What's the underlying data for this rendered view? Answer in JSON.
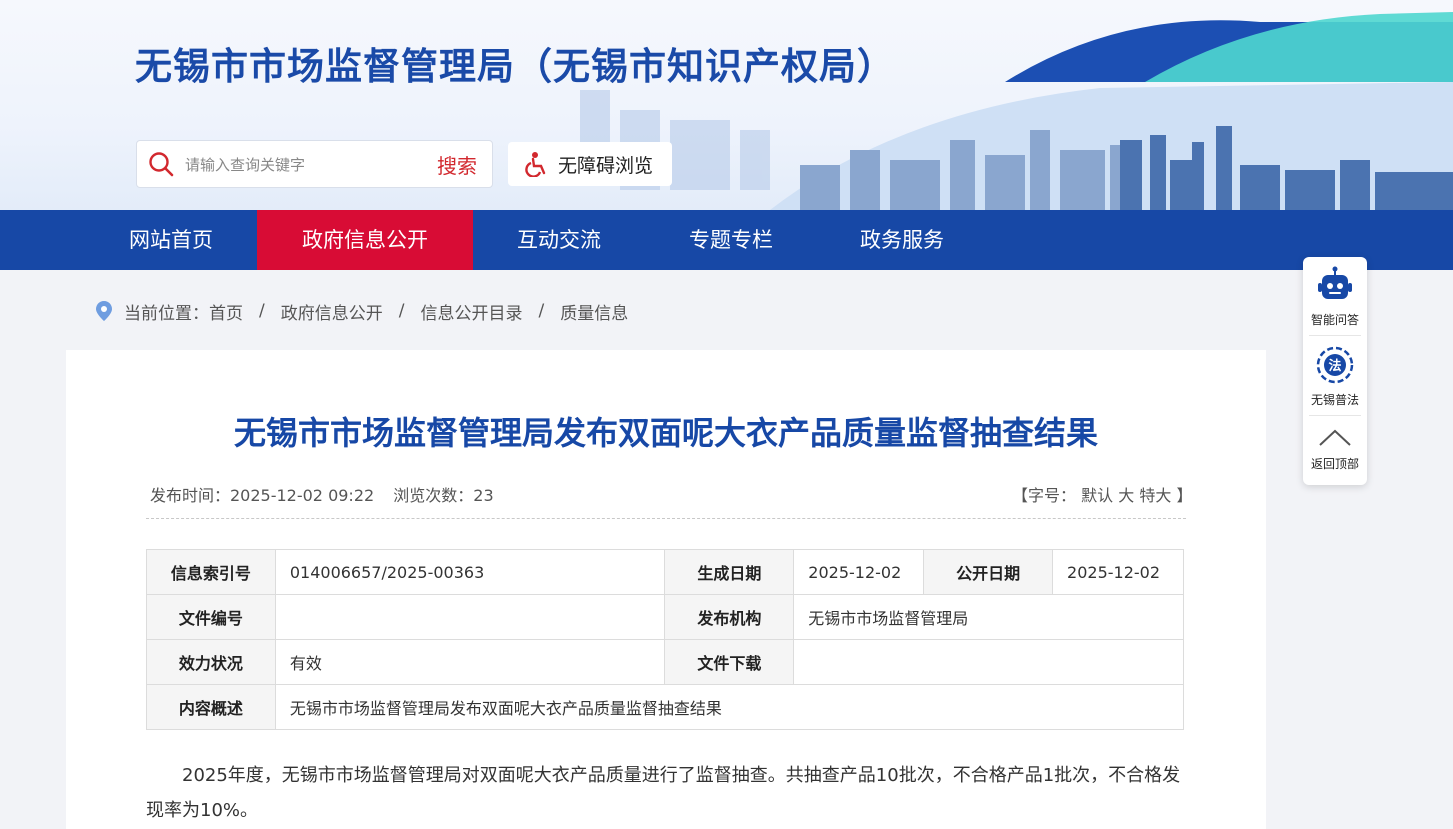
{
  "header": {
    "site_title": "无锡市市场监督管理局（无锡市知识产权局）",
    "search_placeholder": "请输入查询关键字",
    "search_button": "搜索",
    "accessibility_button": "无障碍浏览"
  },
  "nav": {
    "items": [
      {
        "label": "网站首页"
      },
      {
        "label": "政府信息公开"
      },
      {
        "label": "互动交流"
      },
      {
        "label": "专题专栏"
      },
      {
        "label": "政务服务"
      }
    ],
    "active_index": 1
  },
  "breadcrumb": {
    "prefix": "当前位置：",
    "items": [
      "首页",
      "政府信息公开",
      "信息公开目录",
      "质量信息"
    ],
    "separator": "/"
  },
  "article": {
    "title": "无锡市市场监督管理局发布双面呢大衣产品质量监督抽查结果",
    "publish_time": "发布时间：2025-12-02 09:22",
    "views": "浏览次数：23",
    "font_size_prefix": "【字号：",
    "font_sizes": [
      "默认",
      "大",
      "特大"
    ],
    "font_size_suffix": "】",
    "info": {
      "index_label": "信息索引号",
      "index_value": "014006657/2025-00363",
      "created_label": "生成日期",
      "created_value": "2025-12-02",
      "public_label": "公开日期",
      "public_value": "2025-12-02",
      "docno_label": "文件编号",
      "docno_value": "",
      "issuer_label": "发布机构",
      "issuer_value": "无锡市市场监督管理局",
      "status_label": "效力状况",
      "status_value": "有效",
      "download_label": "文件下载",
      "download_value": "",
      "summary_label": "内容概述",
      "summary_value": "无锡市市场监督管理局发布双面呢大衣产品质量监督抽查结果"
    },
    "body": "2025年度，无锡市市场监督管理局对双面呢大衣产品质量进行了监督抽查。共抽查产品10批次，不合格产品1批次，不合格发现率为10%。"
  },
  "float_bar": {
    "qa": "智能问答",
    "law": "无锡普法",
    "top": "返回顶部"
  },
  "colors": {
    "brand_blue": "#1748a6",
    "active_red": "#d80c35",
    "search_red": "#d2282e"
  }
}
